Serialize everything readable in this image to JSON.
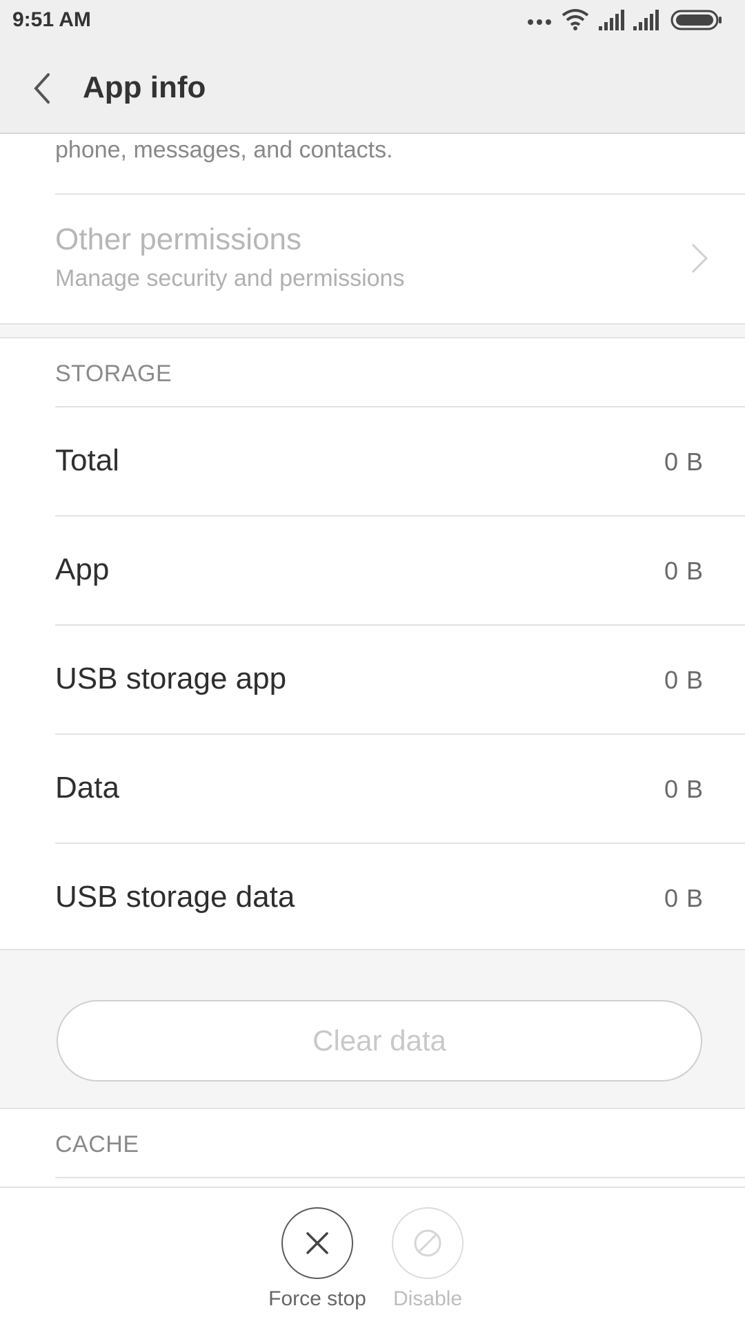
{
  "status_bar": {
    "time": "9:51 AM",
    "icons": [
      "more-dots-icon",
      "wifi-icon",
      "signal-icon",
      "signal-icon",
      "battery-icon"
    ]
  },
  "header": {
    "title": "App info",
    "back_icon": "chevron-left-icon"
  },
  "permissions": {
    "fragment_text": "phone, messages, and contacts.",
    "other_permissions": {
      "title": "Other permissions",
      "subtitle": "Manage security and permissions"
    }
  },
  "storage": {
    "header": "STORAGE",
    "rows": [
      {
        "label": "Total",
        "value": "0 B"
      },
      {
        "label": "App",
        "value": "0 B"
      },
      {
        "label": "USB storage app",
        "value": "0 B"
      },
      {
        "label": "Data",
        "value": "0 B"
      },
      {
        "label": "USB storage data",
        "value": "0 B"
      }
    ],
    "clear_data_label": "Clear data"
  },
  "cache": {
    "header": "CACHE"
  },
  "actions": {
    "force_stop": "Force stop",
    "disable": "Disable"
  },
  "colors": {
    "bar_background": "#efefef",
    "section_background": "#f5f5f5",
    "primary_text": "#2e2e2e",
    "muted_text": "#b0b0b0"
  }
}
